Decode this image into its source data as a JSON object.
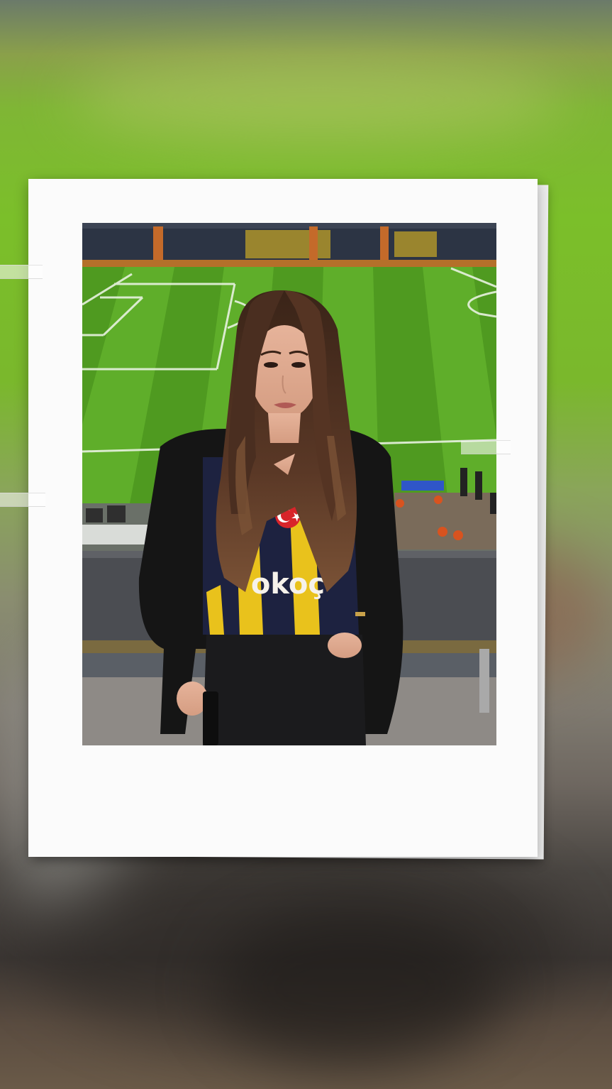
{
  "story": {
    "photo": {
      "jersey_text": "okoç"
    }
  },
  "colors": {
    "pitch_light": "#5fae2a",
    "pitch_dark": "#4f9a20",
    "jersey_navy": "#1d2240",
    "jersey_yellow": "#e9c21c",
    "jacket": "#151515",
    "hair": "#4a2e20",
    "frame": "#fbfbfb"
  }
}
